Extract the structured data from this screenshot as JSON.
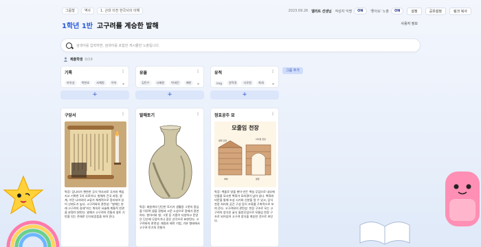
{
  "topbar": {
    "crumbs": [
      "그룹형",
      "역사",
      "1. 근대 이전 한국사의 이해"
    ],
    "date": "2023.09.26",
    "teacher": "엘리트 선생님",
    "anonymous_label": "작성자 익명",
    "anonymous_state": "ON",
    "like_label": "'좋아요' 노출",
    "like_state": "ON",
    "settings_btn": "설정",
    "share_btn": "공유설정",
    "link_btn": "링크 복사"
  },
  "header": {
    "grade": "1학년 1반",
    "title": "고구려를 계승한 발해",
    "settings": "사용자 정보"
  },
  "search": {
    "placeholder": "검색어를 입력하면, 검색어를 포함한 게시물만 노출됩니다."
  },
  "student": {
    "label": "제출학생",
    "count": "0/19"
  },
  "columns": [
    {
      "name": "기록",
      "chips": [
        "마유성",
        "박현호",
        "서채원",
        "이하"
      ]
    },
    {
      "name": "유물",
      "chips": [
        "김민수",
        "나혜원",
        "박세진",
        "배한"
      ]
    },
    {
      "name": "유적",
      "chips": [
        "img",
        "권혁경",
        "다유원",
        "최세"
      ]
    }
  ],
  "add_group": "그룹 추가",
  "cards": [
    {
      "title": "구당서",
      "text": "특징: 당나라가 편찬한 공식 역사서로 국가와 책임지고 기록한 1차 사료이다. 발해의 건국 과정, 왕계, 이민 나라와의 교류가 체계적으로 정리되어 있어 신뢰도가 높다. 고구려와의 관련성: \"발해는 본래 고구려의 갈래\"라는 취지로 서술해 계통적 연관을 분명히 밝힌다. 발해가 고구려의 전통과 영토 기반을 잇는 존재로 인식되었음을 보여 준다."
    },
    {
      "title": "발해토기",
      "text": "특징: 회청색의 단단한 토기가 생활용 그릇의 중심을 이루며 끌을 정형과 고운 소성으로 정제가 정연하다. 항아리와 병, 그릇 등 기종이 다양하고 문양은 단순해 무광이거나 광은 선각으로 표현된다. 고구려와의 관련성: 재질과 제작 기법, 기본 형태에서 고구려 토기의 전통이"
    },
    {
      "title": "정효공주 묘",
      "diagram_title": "모줄임 천장",
      "diagram_labels": [
        "평행 단면",
        "아치형 천장",
        "벽체",
        "평행"
      ],
      "text": "특징: 벽돌로 방을 쌓아 만든 벽실 무덤으로 내부에 인물을 묘사한 벽화가 묘지명이 남아 있다. 벽화와 비문을 통해 조성 시기와 신분을 알 수 있고, 당식 천장 처리와 공간 구성 등이 조화를 구축적으로 보여 준다. 고구려와의 관련성: 천장 구조로 모는 고구려의 양식인 굴식 돌방무덤으로 모줄임 천장 구조로 되어있어 고구려 양식을 계승한 것으로 보인다."
    }
  ]
}
